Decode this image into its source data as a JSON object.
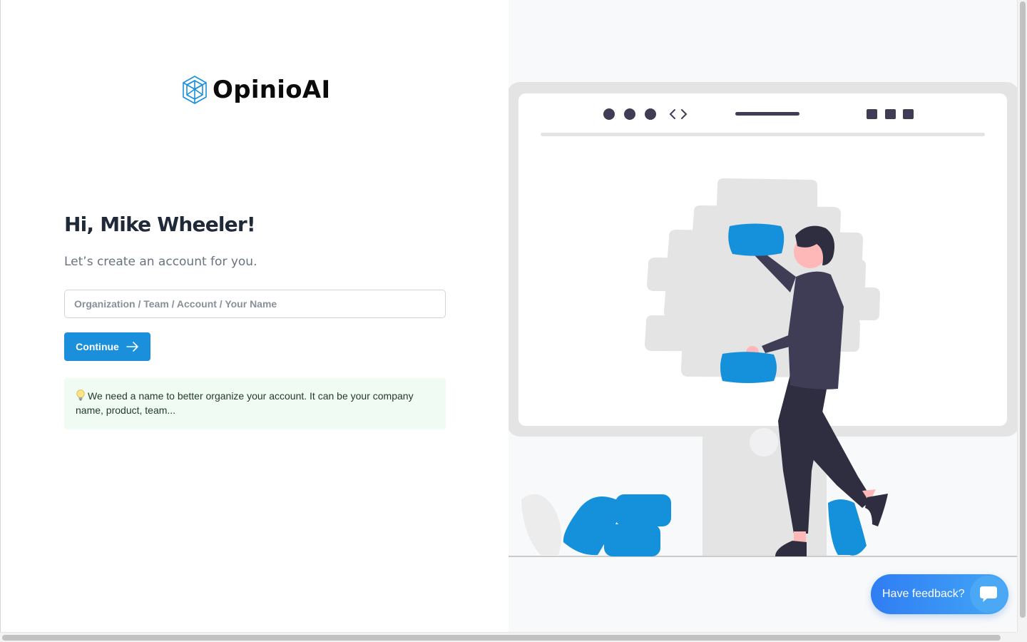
{
  "brand": {
    "name": "OpinioAI",
    "icon": "hexagon-cube-logo-icon",
    "accent_color": "#1a8fdc"
  },
  "signup": {
    "greeting": "Hi, Mike Wheeler!",
    "subtitle": "Let’s create an account for you.",
    "name_input": {
      "value": "",
      "placeholder": "Organization / Team / Account / Your Name"
    },
    "continue_label": "Continue",
    "info_text": "We need a name to better organize your account. It can be your company name, product, team..."
  },
  "feedback": {
    "label": "Have feedback?",
    "icon": "chat-bubble-icon"
  },
  "colors": {
    "primary": "#1a8fdc",
    "illustration_blue": "#1590db",
    "right_panel_bg": "#f8f9fb",
    "info_bg": "#f0fbf3"
  }
}
